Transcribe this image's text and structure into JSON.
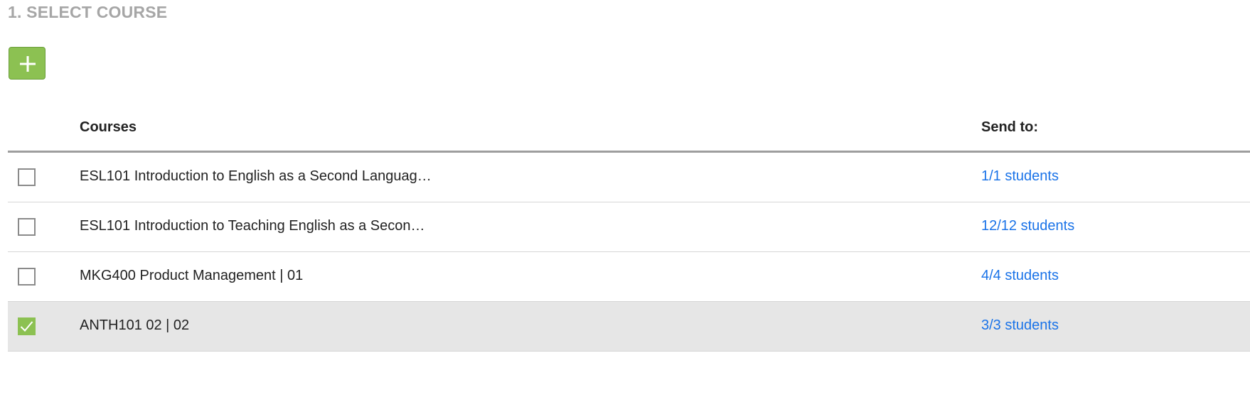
{
  "section": {
    "title": "1. SELECT COURSE"
  },
  "add_button": {
    "icon": "plus-icon",
    "color": "#8cc152"
  },
  "table": {
    "headers": {
      "courses": "Courses",
      "send_to": "Send to:"
    },
    "rows": [
      {
        "course": "ESL101 Introduction to English as a Second Languag…",
        "send_to": "1/1 students",
        "checked": false
      },
      {
        "course": "ESL101 Introduction to Teaching English as a Secon…",
        "send_to": "12/12 students",
        "checked": false
      },
      {
        "course": "MKG400 Product Management | 01",
        "send_to": "4/4 students",
        "checked": false
      },
      {
        "course": "ANTH101 02 | 02",
        "send_to": "3/3 students",
        "checked": true
      }
    ]
  },
  "colors": {
    "accent_green": "#8cc152",
    "link_blue": "#1a73e8",
    "selected_row": "#e6e6e6",
    "section_title": "#a6a6a6"
  }
}
